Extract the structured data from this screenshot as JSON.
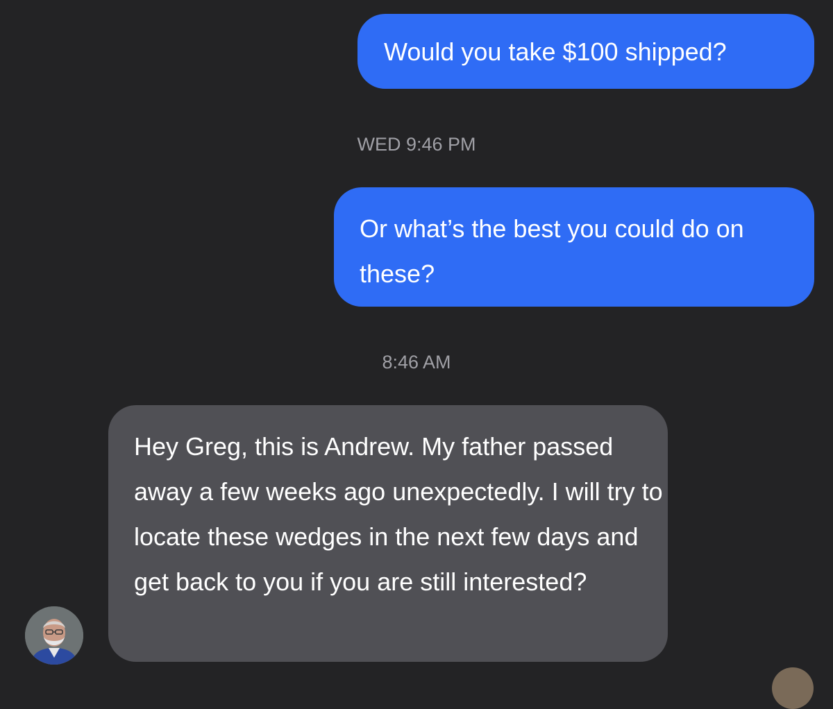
{
  "conversation": {
    "messages": [
      {
        "direction": "outgoing",
        "text": "Would you take $100 shipped?"
      },
      {
        "direction": "outgoing",
        "text": "Or what’s the best you could do on these?"
      },
      {
        "direction": "incoming",
        "text": "Hey Greg, this is Andrew. My father passed away a few weeks ago unexpectedly. I will try to locate these wedges in the next few days and get back to you if you are still interested?"
      }
    ],
    "timestamps": [
      "WED 9:46 PM",
      "8:46 AM"
    ]
  },
  "colors": {
    "background": "#232325",
    "outgoing_bubble": "#2f6cf5",
    "incoming_bubble": "#505055",
    "timestamp_text": "#a0a0a6"
  },
  "icons": {
    "sender_avatar": "person-photo-avatar"
  }
}
